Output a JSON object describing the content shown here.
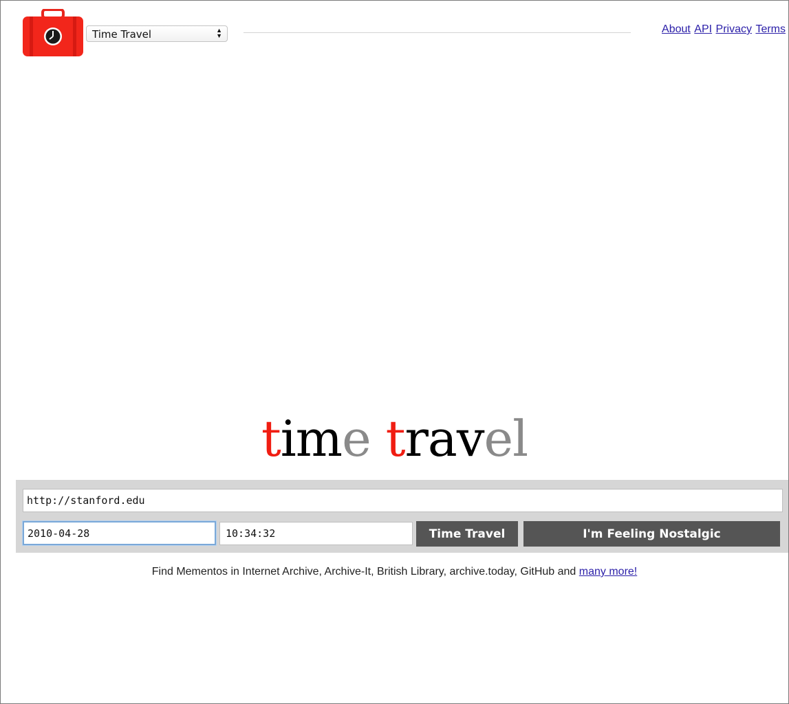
{
  "header": {
    "select": {
      "selected": "Time Travel"
    },
    "links": [
      {
        "label": "About"
      },
      {
        "label": "API"
      },
      {
        "label": "Privacy"
      },
      {
        "label": "Terms"
      }
    ]
  },
  "brand": {
    "word1": {
      "a": "t",
      "b": "im",
      "c": "e"
    },
    "word2": {
      "a": "t",
      "b": "rav",
      "c": "el"
    }
  },
  "search": {
    "url_value": "http://stanford.edu",
    "date_value": "2010-04-28",
    "time_value": "10:34:32",
    "time_travel_label": "Time Travel",
    "nostalgic_label": "I'm Feeling Nostalgic"
  },
  "footer": {
    "text": "Find Mementos in Internet Archive, Archive-It, British Library, archive.today, GitHub and ",
    "link": "many more!"
  },
  "colors": {
    "brand_red": "#f01d12",
    "brand_grey": "#8a8a8a",
    "button_bg": "#555555",
    "link": "#2a1ea8"
  },
  "icons": {
    "logo": "suitcase-clock-icon",
    "select_arrows": "up-down-arrows-icon"
  }
}
